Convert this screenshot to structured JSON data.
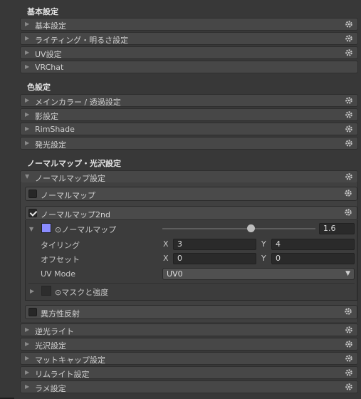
{
  "sections": {
    "basic_title": "基本設定",
    "color_title": "色設定",
    "normal_title": "ノーマルマップ・光沢設定"
  },
  "basic_folds": [
    "基本設定",
    "ライティング・明るさ設定",
    "UV設定",
    "VRChat"
  ],
  "color_folds": [
    "メインカラー / 透過設定",
    "影設定",
    "RimShade",
    "発光設定"
  ],
  "normal_fold": "ノーマルマップ設定",
  "normal_map": {
    "label": "ノーマルマップ",
    "checked": false
  },
  "normal_map_2nd": {
    "label": "ノーマルマップ2nd",
    "checked": true,
    "texture_label": "⊙ノーマルマップ",
    "strength": "1.6",
    "strength_fraction": 0.58,
    "tiling_label": "タイリング",
    "offset_label": "オフセット",
    "x_label": "X",
    "y_label": "Y",
    "tiling_x": "3",
    "tiling_y": "4",
    "offset_x": "0",
    "offset_y": "0",
    "uv_mode_label": "UV Mode",
    "uv_mode_value": "UV0",
    "mask_label": "⊙マスクと強度"
  },
  "anisotropy": {
    "label": "異方性反射",
    "checked": false
  },
  "bottom_folds": [
    "逆光ライト",
    "光沢設定",
    "マットキャップ設定",
    "リムライト設定",
    "ラメ設定"
  ],
  "icons": {
    "gear": "gear-icon",
    "fold_closed": "triangle-right-icon",
    "fold_open": "triangle-down-icon",
    "dropdown": "chevron-down-icon"
  },
  "colors": {
    "normal_swatch": "#8a8cff",
    "background": "#383838",
    "header": "#474747"
  }
}
